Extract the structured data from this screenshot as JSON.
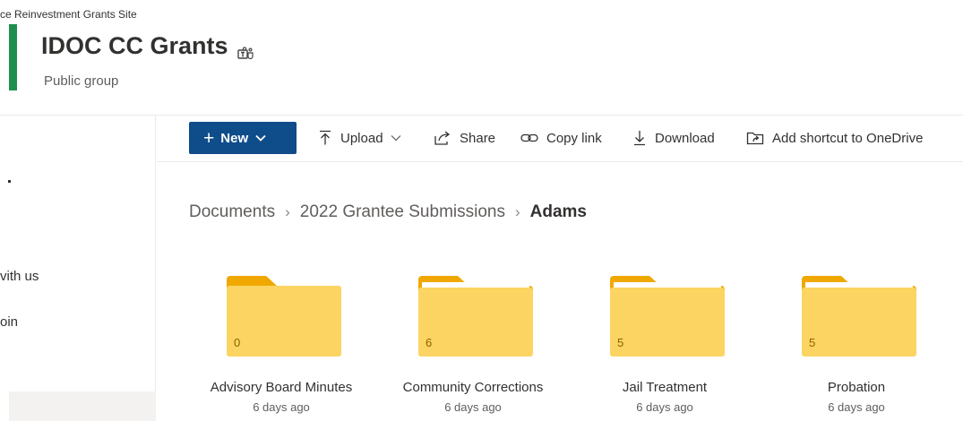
{
  "site": {
    "breadcrumb": "ce Reinvestment Grants Site",
    "title": "IDOC CC Grants",
    "subtitle": "Public group",
    "accent_color": "#1e8f4e",
    "teams_icon": "teams-icon"
  },
  "left_nav": {
    "items": [
      {
        "label": "vith us"
      },
      {
        "label": "oin"
      }
    ]
  },
  "command_bar": {
    "new_label": "New",
    "upload_label": "Upload",
    "share_label": "Share",
    "copy_link_label": "Copy link",
    "download_label": "Download",
    "shortcut_label": "Add shortcut to OneDrive",
    "primary_color": "#0f4c8a"
  },
  "breadcrumb": {
    "items": [
      "Documents",
      "2022 Grantee Submissions"
    ],
    "current": "Adams"
  },
  "folders": [
    {
      "name": "Advisory Board Minutes",
      "count": "0",
      "modified": "6 days ago"
    },
    {
      "name": "Community Corrections",
      "count": "6",
      "modified": "6 days ago"
    },
    {
      "name": "Jail Treatment",
      "count": "5",
      "modified": "6 days ago"
    },
    {
      "name": "Probation",
      "count": "5",
      "modified": "6 days ago"
    }
  ]
}
